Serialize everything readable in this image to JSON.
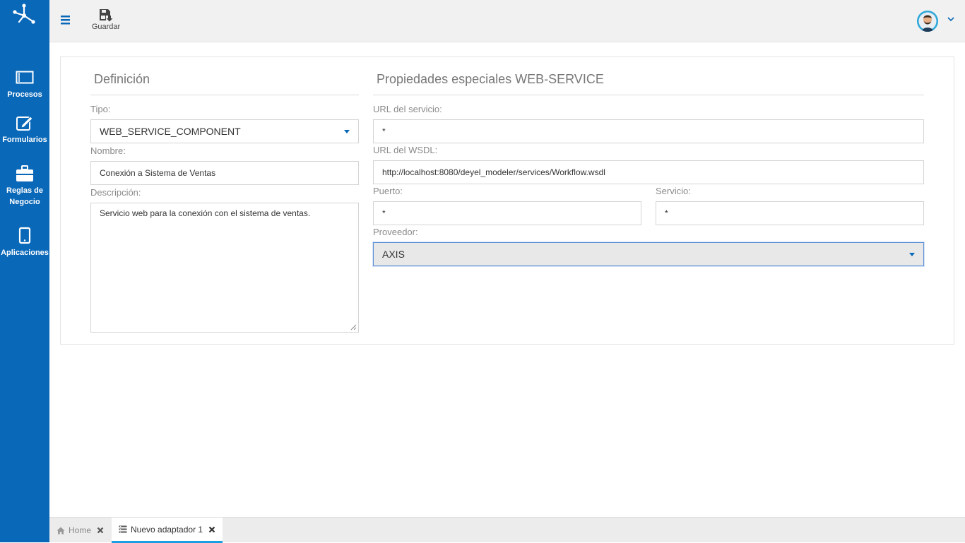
{
  "sidebar": {
    "items": [
      {
        "label": "Procesos",
        "icon": "window-icon"
      },
      {
        "label": "Formularios",
        "icon": "edit-icon"
      },
      {
        "label": "Reglas de Negocio",
        "icon": "briefcase-icon"
      },
      {
        "label": "Aplicaciones",
        "icon": "tablet-icon"
      }
    ]
  },
  "toolbar": {
    "save_label": "Guardar"
  },
  "definicion": {
    "title": "Definición",
    "tipo_label": "Tipo:",
    "tipo_value": "WEB_SERVICE_COMPONENT",
    "nombre_label": "Nombre:",
    "nombre_value": "Conexión a Sistema de Ventas",
    "descripcion_label": "Descripción:",
    "descripcion_value": "Servicio web para la conexión con el sistema de ventas."
  },
  "propiedades": {
    "title": "Propiedades especiales WEB-SERVICE",
    "url_servicio_label": "URL del servicio:",
    "url_servicio_value": "*",
    "url_wsdl_label": "URL del WSDL:",
    "url_wsdl_value": "http://localhost:8080/deyel_modeler/services/Workflow.wsdl",
    "puerto_label": "Puerto:",
    "puerto_value": "*",
    "servicio_label": "Servicio:",
    "servicio_value": "*",
    "proveedor_label": "Proveedor:",
    "proveedor_value": "AXIS"
  },
  "tabs": [
    {
      "label": "Home",
      "active": false
    },
    {
      "label": "Nuevo adaptador 1",
      "active": true
    }
  ],
  "colors": {
    "brand": "#0a68b8",
    "active_tab": "#1a9fe0"
  }
}
